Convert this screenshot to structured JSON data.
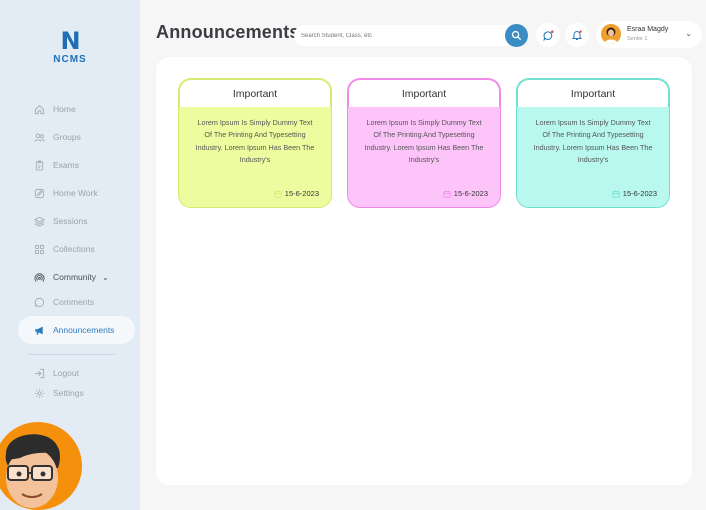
{
  "brand": {
    "logo_letter": "N",
    "name": "NCMS"
  },
  "sidebar": {
    "items": [
      {
        "label": "Home",
        "icon": "home-icon"
      },
      {
        "label": "Groups",
        "icon": "users-icon"
      },
      {
        "label": "Exams",
        "icon": "clipboard-icon"
      },
      {
        "label": "Home Work",
        "icon": "edit-icon"
      },
      {
        "label": "Sessions",
        "icon": "layers-icon"
      },
      {
        "label": "Collections",
        "icon": "grid-icon"
      },
      {
        "label": "Community",
        "icon": "broadcast-icon"
      },
      {
        "label": "Comments",
        "icon": "comment-icon"
      },
      {
        "label": "Announcements",
        "icon": "megaphone-icon"
      }
    ],
    "active": "Announcements",
    "bottom": [
      {
        "label": "Logout",
        "icon": "logout-icon"
      },
      {
        "label": "Settings",
        "icon": "gear-icon"
      }
    ]
  },
  "header": {
    "title": "Announcements",
    "search_placeholder": "Search Student, Class, etc"
  },
  "user": {
    "name": "Esraa Magdy",
    "role": "Senior 1"
  },
  "announcements": [
    {
      "title": "Important",
      "body": "Lorem Ipsum Is Simply Dummy Text Of The Printing And Typesetting Industry. Lorem Ipsum Has Been The Industry's",
      "date": "15-6-2023",
      "color": "#eefca0",
      "accent": "#d6ea72"
    },
    {
      "title": "Important",
      "body": "Lorem Ipsum Is Simply Dummy Text Of The Printing And Typesetting Industry. Lorem Ipsum Has Been The Industry's",
      "date": "15-6-2023",
      "color": "#fdc4f9",
      "accent": "#f08ae8"
    },
    {
      "title": "Important",
      "body": "Lorem Ipsum Is Simply Dummy Text Of The Printing And Typesetting Industry. Lorem Ipsum Has Been The Industry's",
      "date": "15-6-2023",
      "color": "#b8f8ee",
      "accent": "#6fe0cf"
    }
  ]
}
